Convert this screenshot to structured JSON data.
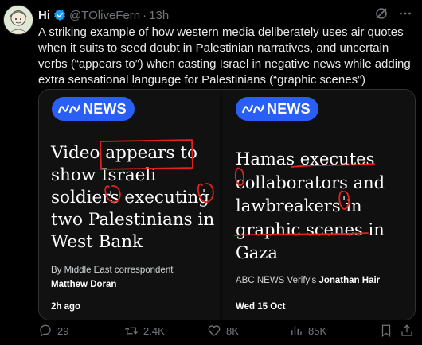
{
  "author": {
    "display_name": "Hi",
    "handle": "@TOliveFern",
    "separator": "·",
    "time": "13h"
  },
  "tweet_text": "A striking example of how western media deliberately uses air quotes when it suits to seed doubt in Palestinian narratives, and uncertain verbs (“appears to”) when casting Israel in negative news while adding extra sensational language for Palestinians (“graphic scenes”)",
  "media": {
    "left": {
      "brand": "NEWS",
      "headline_lines": [
        "Video appears to",
        "show Israeli",
        "soldiers executing",
        "two Palestinians in",
        "West Bank"
      ],
      "byline": "By Middle East correspondent",
      "author": "Matthew Doran",
      "date": "2h ago"
    },
    "right": {
      "brand": "NEWS",
      "headline_lines": [
        "Hamas executes",
        "collaborators and",
        "lawbreakers in",
        "graphic scenes in",
        "Gaza"
      ],
      "byline_prefix": "ABC NEWS Verify's",
      "author": "Jonathan Hair",
      "date": "Wed 15 Oct"
    },
    "annotation_color": "#e0231c",
    "brand_color": "#2a5ff5"
  },
  "actions": {
    "replies": "29",
    "reposts": "2.4K",
    "likes": "8K",
    "views": "85K"
  },
  "icons": [
    "verified-badge-icon",
    "grok-icon",
    "more-icon",
    "reply-icon",
    "repost-icon",
    "like-icon",
    "views-icon",
    "bookmark-icon",
    "share-icon"
  ]
}
